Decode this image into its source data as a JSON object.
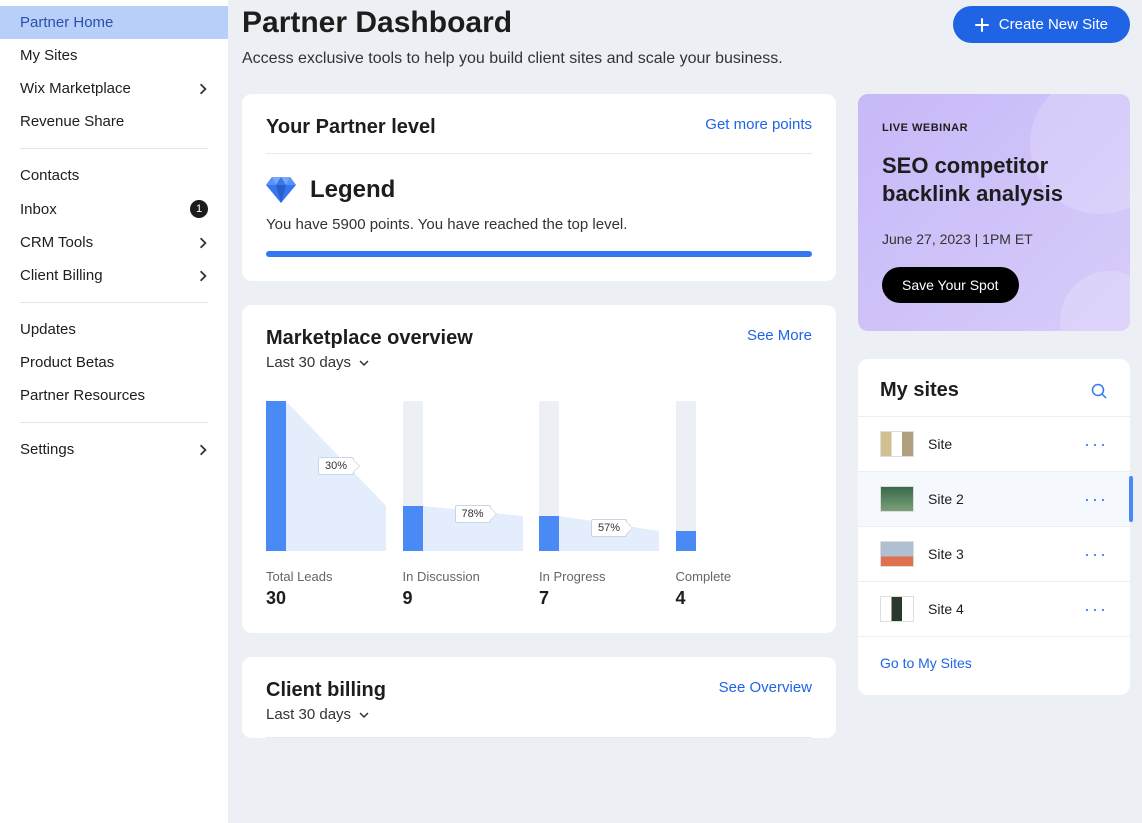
{
  "sidebar": {
    "items": [
      {
        "label": "Partner Home",
        "active": true
      },
      {
        "label": "My Sites"
      },
      {
        "label": "Wix Marketplace",
        "chevron": true
      },
      {
        "label": "Revenue Share"
      }
    ],
    "group2": [
      {
        "label": "Contacts"
      },
      {
        "label": "Inbox",
        "badge": "1"
      },
      {
        "label": "CRM Tools",
        "chevron": true
      },
      {
        "label": "Client Billing",
        "chevron": true
      }
    ],
    "group3": [
      {
        "label": "Updates"
      },
      {
        "label": "Product Betas"
      },
      {
        "label": "Partner Resources"
      }
    ],
    "group4": [
      {
        "label": "Settings",
        "chevron": true
      }
    ]
  },
  "header": {
    "title": "Partner Dashboard",
    "subtitle": "Access exclusive tools to help you build client sites and scale your business.",
    "create_button": "Create New Site"
  },
  "partner_level": {
    "card_title": "Your Partner level",
    "more_link": "Get more points",
    "level_name": "Legend",
    "level_text": "You have 5900 points. You have reached the top level."
  },
  "marketplace": {
    "title": "Marketplace overview",
    "range": "Last 30 days",
    "see_more": "See More",
    "transitions": [
      "30%",
      "78%",
      "57%"
    ],
    "stats": [
      {
        "label": "Total Leads",
        "value": "30"
      },
      {
        "label": "In Discussion",
        "value": "9"
      },
      {
        "label": "In Progress",
        "value": "7"
      },
      {
        "label": "Complete",
        "value": "4"
      }
    ]
  },
  "client_billing": {
    "title": "Client billing",
    "range": "Last 30 days",
    "see_overview": "See Overview"
  },
  "webinar": {
    "label": "LIVE WEBINAR",
    "title": "SEO competitor backlink analysis",
    "date": "June 27, 2023 | 1PM ET",
    "cta": "Save Your Spot"
  },
  "mysites": {
    "title": "My sites",
    "items": [
      "Site",
      "Site 2",
      "Site 3",
      "Site 4"
    ],
    "goto": "Go to My Sites"
  },
  "chart_data": {
    "type": "bar",
    "title": "Marketplace overview — Last 30 days",
    "categories": [
      "Total Leads",
      "In Discussion",
      "In Progress",
      "Complete"
    ],
    "values": [
      30,
      9,
      7,
      4
    ],
    "conversion_labels": [
      "30%",
      "78%",
      "57%"
    ],
    "xlabel": "",
    "ylabel": "",
    "ylim": [
      0,
      30
    ]
  }
}
